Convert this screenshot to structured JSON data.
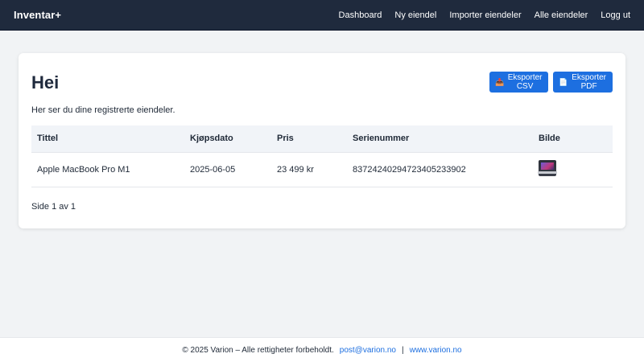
{
  "nav": {
    "brand": "Inventar+",
    "links": [
      "Dashboard",
      "Ny eiendel",
      "Importer eiendeler",
      "Alle eiendeler",
      "Logg ut"
    ]
  },
  "main": {
    "title": "Hei",
    "subtitle": "Her ser du dine registrerte eiendeler.",
    "export_csv_label": "Eksporter CSV",
    "export_pdf_label": "Eksporter PDF",
    "table": {
      "headers": [
        "Tittel",
        "Kjøpsdato",
        "Pris",
        "Serienummer",
        "Bilde"
      ],
      "rows": [
        {
          "title": "Apple MacBook Pro M1",
          "date": "2025-06-05",
          "price": "23 499 kr",
          "serial": "83724240294723405233902",
          "image_icon": "laptop-thumbnail"
        }
      ]
    },
    "pagination": "Side 1 av 1"
  },
  "footer": {
    "copyright": "© 2025 Varion – Alle rettigheter forbeholdt.",
    "email": "post@varion.no",
    "separator": "|",
    "website": "www.varion.no"
  },
  "colors": {
    "navbar_bg": "#1f2a3d",
    "accent": "#1d6fe0",
    "page_bg": "#f1f3f5"
  }
}
